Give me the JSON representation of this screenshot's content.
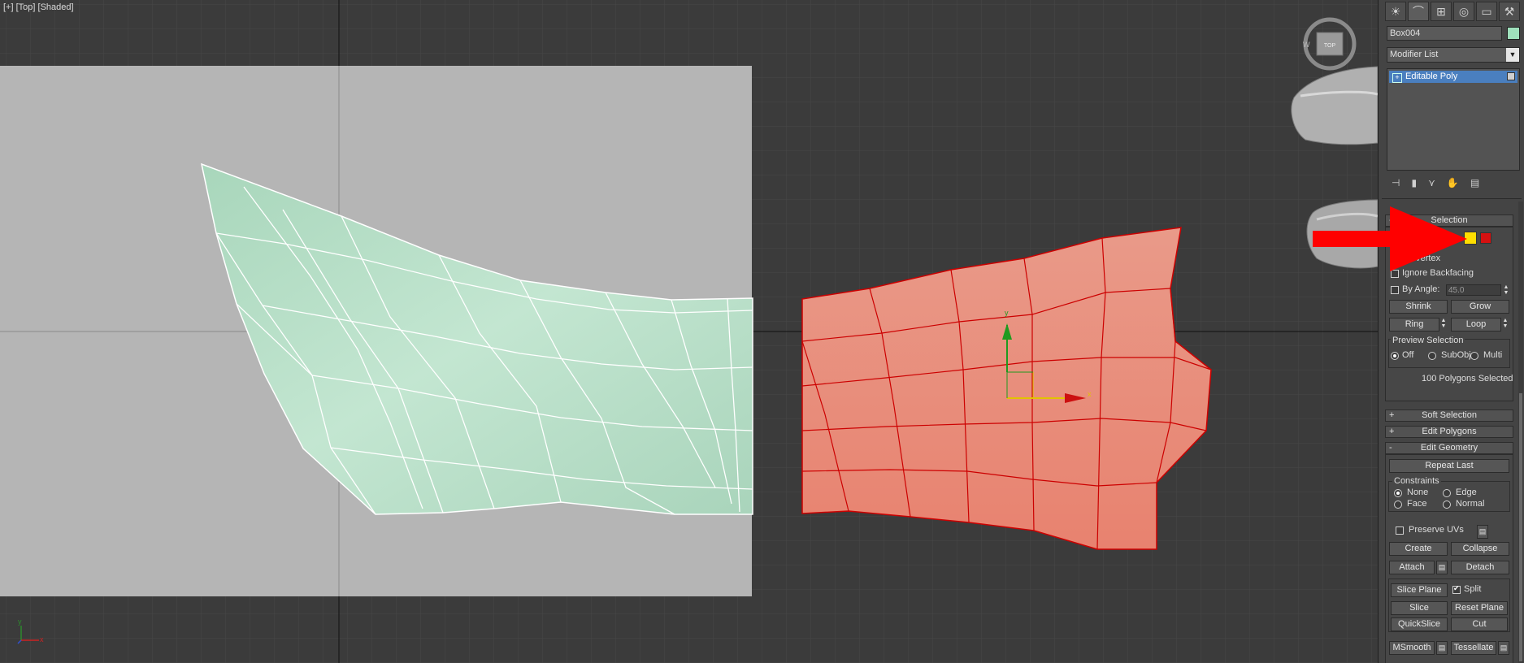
{
  "viewport": {
    "label_plus": "[+]",
    "label_view": "[Top]",
    "label_shading": "[Shaded]",
    "viewcube_text": "TOP"
  },
  "panel": {
    "tabs": [
      "create-icon",
      "modify-icon",
      "hierarchy-icon",
      "motion-icon",
      "display-icon",
      "utilities-icon"
    ],
    "object_name": "Box004",
    "object_color": "#9fe0bc",
    "modifier_list": "Modifier List",
    "stack_item": "Editable Poly",
    "selection": {
      "title": "Selection",
      "by_vertex": "By Vertex",
      "ignore_backfacing": "Ignore Backfacing",
      "by_angle": "By Angle:",
      "angle_value": "45.0",
      "shrink": "Shrink",
      "grow": "Grow",
      "ring": "Ring",
      "loop": "Loop",
      "preview_title": "Preview Selection",
      "preview_off": "Off",
      "preview_subobj": "SubObj",
      "preview_multi": "Multi",
      "status": "100 Polygons Selected"
    },
    "soft_selection": "Soft Selection",
    "edit_polygons": "Edit Polygons",
    "edit_geometry": {
      "title": "Edit Geometry",
      "repeat_last": "Repeat Last",
      "constraints": "Constraints",
      "none": "None",
      "edge": "Edge",
      "face": "Face",
      "normal": "Normal",
      "preserve_uvs": "Preserve UVs",
      "create": "Create",
      "collapse": "Collapse",
      "attach": "Attach",
      "detach": "Detach",
      "slice_plane": "Slice Plane",
      "split": "Split",
      "slice": "Slice",
      "reset_plane": "Reset Plane",
      "quickslice": "QuickSlice",
      "cut": "Cut",
      "msmooth": "MSmooth",
      "tessellate": "Tessellate"
    }
  },
  "gizmo": {
    "x_label": "x",
    "y_label": "y"
  },
  "axis_tripod": {
    "x_label": "x",
    "y_label": "y"
  },
  "colors": {
    "green_mesh": "#b7dcc6",
    "red_mesh": "#e8907e",
    "annotation_arrow": "#ff0000"
  }
}
